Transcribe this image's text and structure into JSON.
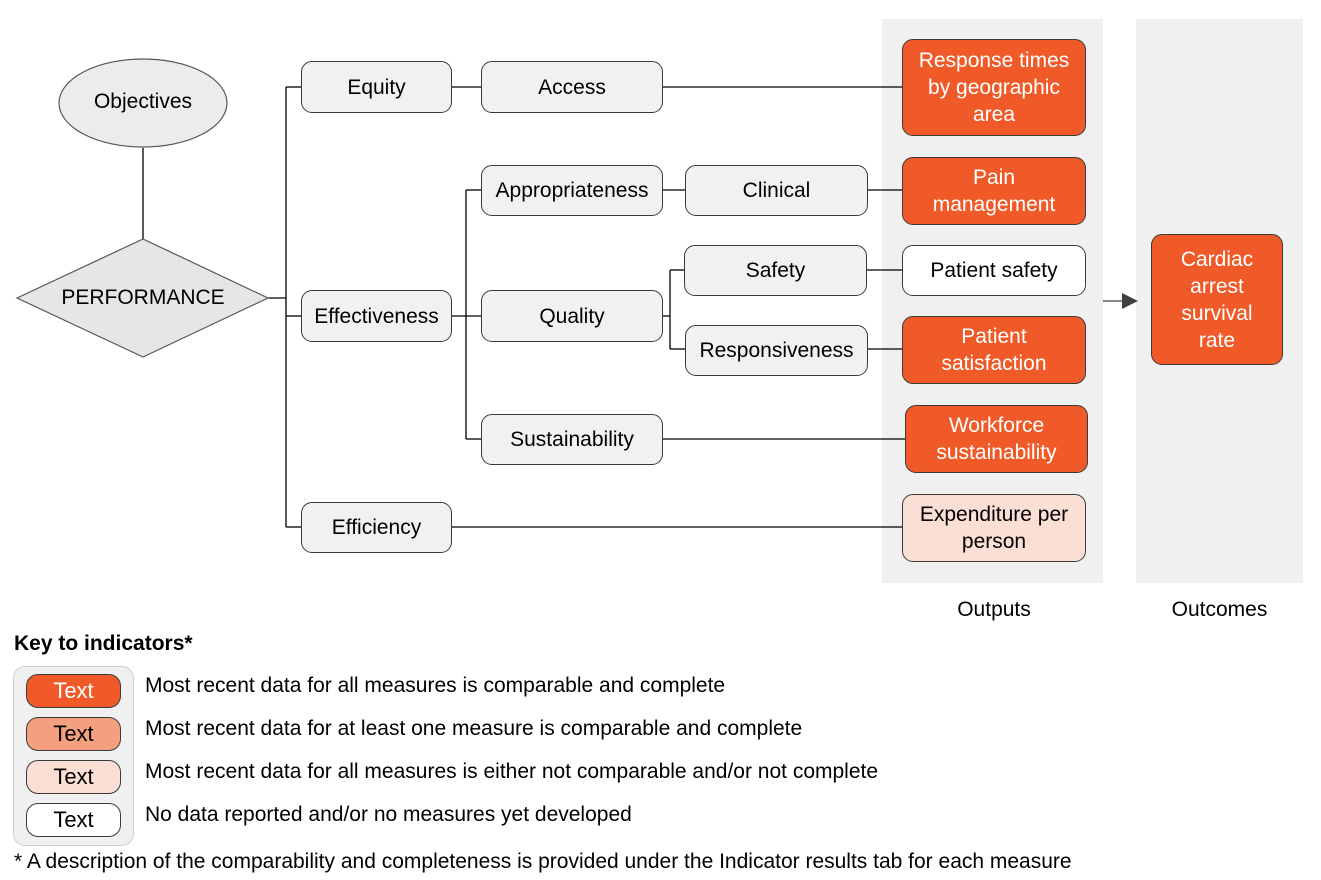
{
  "diagram": {
    "objectives_label": "Objectives",
    "performance_label": "PERFORMANCE",
    "level1": [
      {
        "label": "Equity"
      },
      {
        "label": "Effectiveness"
      },
      {
        "label": "Efficiency"
      }
    ],
    "level2": [
      {
        "label": "Access"
      },
      {
        "label": "Appropriateness"
      },
      {
        "label": "Quality"
      },
      {
        "label": "Sustainability"
      }
    ],
    "level3": [
      {
        "label": "Clinical"
      },
      {
        "label": "Safety"
      },
      {
        "label": "Responsiveness"
      }
    ],
    "outputs": [
      {
        "label": "Response times by geographic area",
        "status": "full"
      },
      {
        "label": "Pain management",
        "status": "full"
      },
      {
        "label": "Patient safety",
        "status": "none"
      },
      {
        "label": "Patient satisfaction",
        "status": "full"
      },
      {
        "label": "Workforce sustainability",
        "status": "full"
      },
      {
        "label": "Expenditure per person",
        "status": "light"
      }
    ],
    "outcomes": [
      {
        "label": "Cardiac arrest survival rate",
        "status": "full"
      }
    ],
    "outputs_label": "Outputs",
    "outcomes_label": "Outcomes"
  },
  "key": {
    "title": "Key to indicators*",
    "items": [
      {
        "swatch": "Text",
        "status": "full",
        "color": "#f05a28",
        "description": "Most recent data for all measures is comparable and complete"
      },
      {
        "swatch": "Text",
        "status": "partial",
        "color": "#f49f80",
        "description": "Most recent data for at least one measure is comparable and complete"
      },
      {
        "swatch": "Text",
        "status": "light",
        "color": "#fbdfd4",
        "description": "Most recent data for all measures is either not comparable and/or not complete"
      },
      {
        "swatch": "Text",
        "status": "none",
        "color": "#ffffff",
        "description": "No data reported and/or no measures yet developed"
      }
    ],
    "footnote": "* A description of the comparability and completeness is provided under the Indicator results tab for each measure"
  }
}
